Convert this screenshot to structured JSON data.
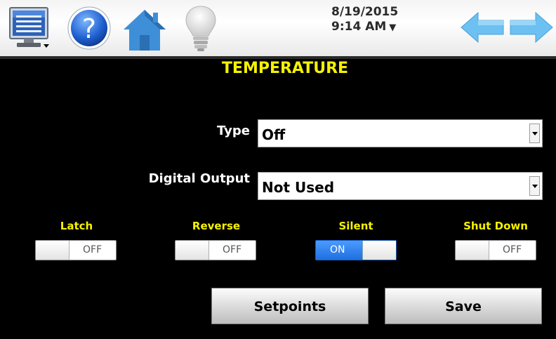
{
  "header": {
    "date": "8/19/2015",
    "time": "9:14 AM",
    "time_dropdown_icon": "triangle-down-icon",
    "icons": [
      "monitor-menu-icon",
      "help-icon",
      "home-icon",
      "lightbulb-icon",
      "back-arrow-icon",
      "forward-arrow-icon"
    ]
  },
  "page": {
    "title": "TEMPERATURE"
  },
  "form": {
    "type": {
      "label": "Type",
      "value": "Off"
    },
    "digital_output": {
      "label": "Digital Output",
      "value": "Not Used"
    }
  },
  "toggles": [
    {
      "label": "Latch",
      "state": "OFF"
    },
    {
      "label": "Reverse",
      "state": "OFF"
    },
    {
      "label": "Silent",
      "state": "ON"
    },
    {
      "label": "Shut Down",
      "state": "OFF"
    }
  ],
  "buttons": {
    "setpoints": "Setpoints",
    "save": "Save"
  },
  "colors": {
    "background": "#000000",
    "title": "#f6f200",
    "toggle_label": "#f6f200",
    "toggle_on": "#2f80f0",
    "arrow_blue": "#5bb8f0"
  }
}
